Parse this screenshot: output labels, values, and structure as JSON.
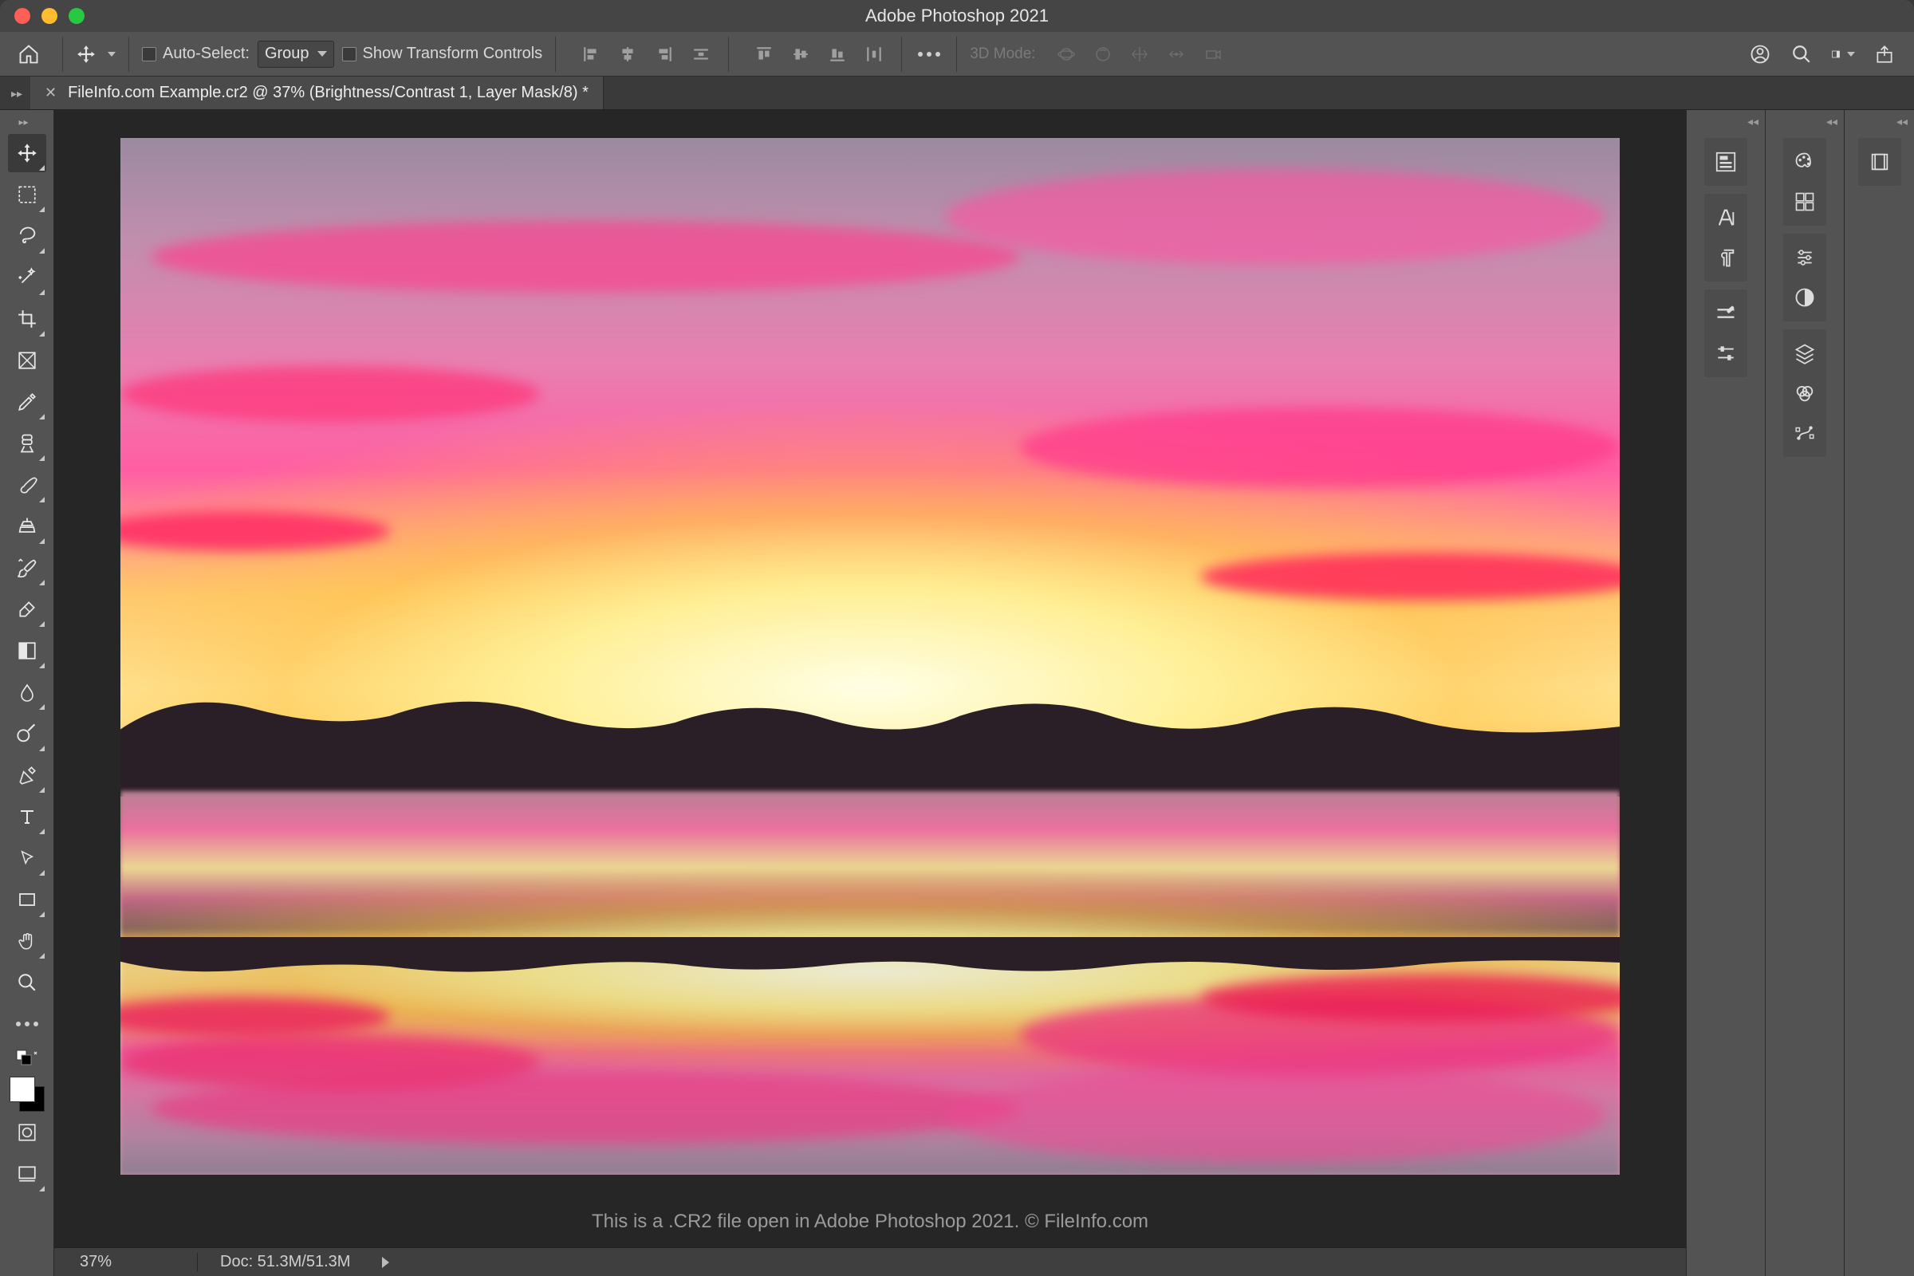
{
  "app": {
    "title": "Adobe Photoshop 2021"
  },
  "optionsbar": {
    "auto_select_label": "Auto-Select:",
    "group_select": "Group",
    "show_transform_label": "Show Transform Controls",
    "mode_3d_label": "3D Mode:"
  },
  "document": {
    "tab_title": "FileInfo.com Example.cr2 @ 37% (Brightness/Contrast 1, Layer Mask/8) *"
  },
  "toolbox": {
    "tools": [
      "move-tool",
      "rectangular-marquee-tool",
      "lasso-tool",
      "magic-wand-tool",
      "crop-tool",
      "frame-tool",
      "eyedropper-tool",
      "spot-healing-tool",
      "brush-tool",
      "clone-stamp-tool",
      "history-brush-tool",
      "eraser-tool",
      "gradient-tool",
      "blur-tool",
      "dodge-tool",
      "pen-tool",
      "type-tool",
      "path-selection-tool",
      "rectangle-tool",
      "hand-tool",
      "zoom-tool",
      "edit-toolbar",
      "swap-colors",
      "quick-mask",
      "screen-mode"
    ]
  },
  "statusbar": {
    "zoom": "37%",
    "docinfo": "Doc: 51.3M/51.3M"
  },
  "caption": "This is a .CR2 file open in Adobe Photoshop 2021. © FileInfo.com",
  "panels": {
    "col1": [
      "history",
      "character",
      "paragraph",
      "brush-settings",
      "modifiers"
    ],
    "col2": [
      "color",
      "swatches",
      "adjustments",
      "styles",
      "layers",
      "channels",
      "paths"
    ],
    "col3": [
      "libraries"
    ]
  },
  "right_icons": [
    "cloud-docs",
    "search",
    "workspace",
    "share"
  ]
}
